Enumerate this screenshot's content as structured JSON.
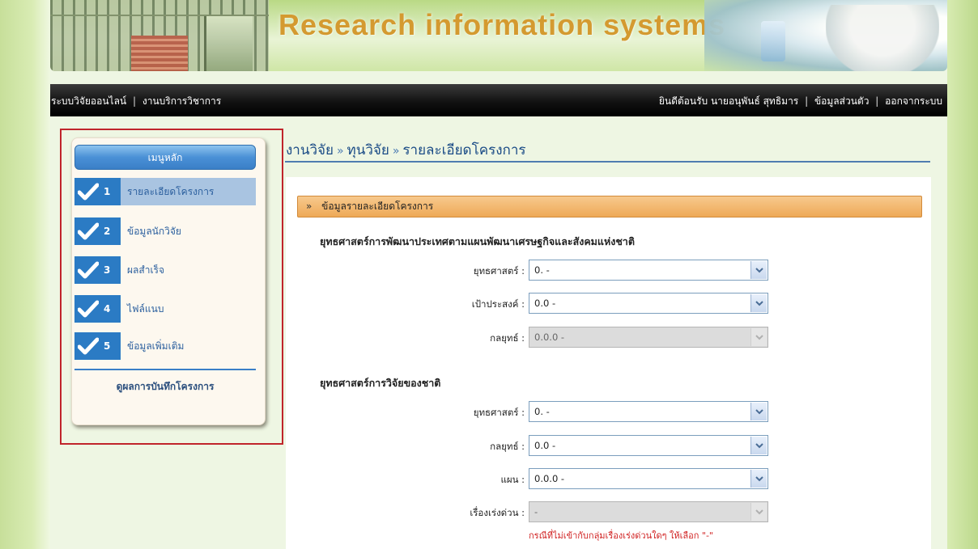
{
  "banner": {
    "title": "Research information systems"
  },
  "topbar": {
    "left_links": [
      "ระบบวิจัยออนไลน์",
      "งานบริการวิชาการ"
    ],
    "welcome": "ยินดีต้อนรับ นายอนุพันธ์ สุทธิมาร",
    "profile_link": "ข้อมูลส่วนตัว",
    "logout_link": "ออกจากระบบ",
    "separator": "|"
  },
  "sidebar": {
    "header": "เมนูหลัก",
    "items": [
      {
        "num": "1",
        "label": "รายละเอียดโครงการ",
        "active": true
      },
      {
        "num": "2",
        "label": "ข้อมูลนักวิจัย",
        "active": false
      },
      {
        "num": "3",
        "label": "ผลสำเร็จ",
        "active": false
      },
      {
        "num": "4",
        "label": "ไฟล์แนบ",
        "active": false
      },
      {
        "num": "5",
        "label": "ข้อมูลเพิ่มเติม",
        "active": false
      }
    ],
    "footer_link": "ดูผลการบันทึกโครงการ"
  },
  "breadcrumb": {
    "items": [
      "งานวิจัย",
      "ทุนวิจัย",
      "รายละเอียดโครงการ"
    ],
    "separator": "»"
  },
  "section": {
    "header": "ข้อมูลรายละเอียดโครงการ",
    "group1": {
      "title": "ยุทธศาสตร์การพัฒนาประเทศตามแผนพัฒนาเศรษฐกิจและสังคมแห่งชาติ",
      "fields": [
        {
          "label": "ยุทธศาสตร์ :",
          "value": "0. -",
          "disabled": false
        },
        {
          "label": "เป้าประสงค์ :",
          "value": "0.0 -",
          "disabled": false
        },
        {
          "label": "กลยุทธ์ :",
          "value": "0.0.0 -",
          "disabled": true
        }
      ]
    },
    "group2": {
      "title": "ยุทธศาสตร์การวิจัยของชาติ",
      "fields": [
        {
          "label": "ยุทธศาสตร์ :",
          "value": "0. -",
          "disabled": false
        },
        {
          "label": "กลยุทธ์ :",
          "value": "0.0 -",
          "disabled": false
        },
        {
          "label": "แผน :",
          "value": "0.0.0 -",
          "disabled": false
        },
        {
          "label": "เรื่องเร่งด่วน :",
          "value": "-",
          "disabled": true
        }
      ],
      "hint": "กรณีที่ไม่เข้ากับกลุ่มเรื่องเร่งด่วนใดๆ ให้เลือก \"-\""
    }
  },
  "colors": {
    "accent_blue": "#2b7bc4",
    "section_orange": "#eea957",
    "highlight_red": "#c0242b",
    "banner_title": "#d49a30"
  }
}
